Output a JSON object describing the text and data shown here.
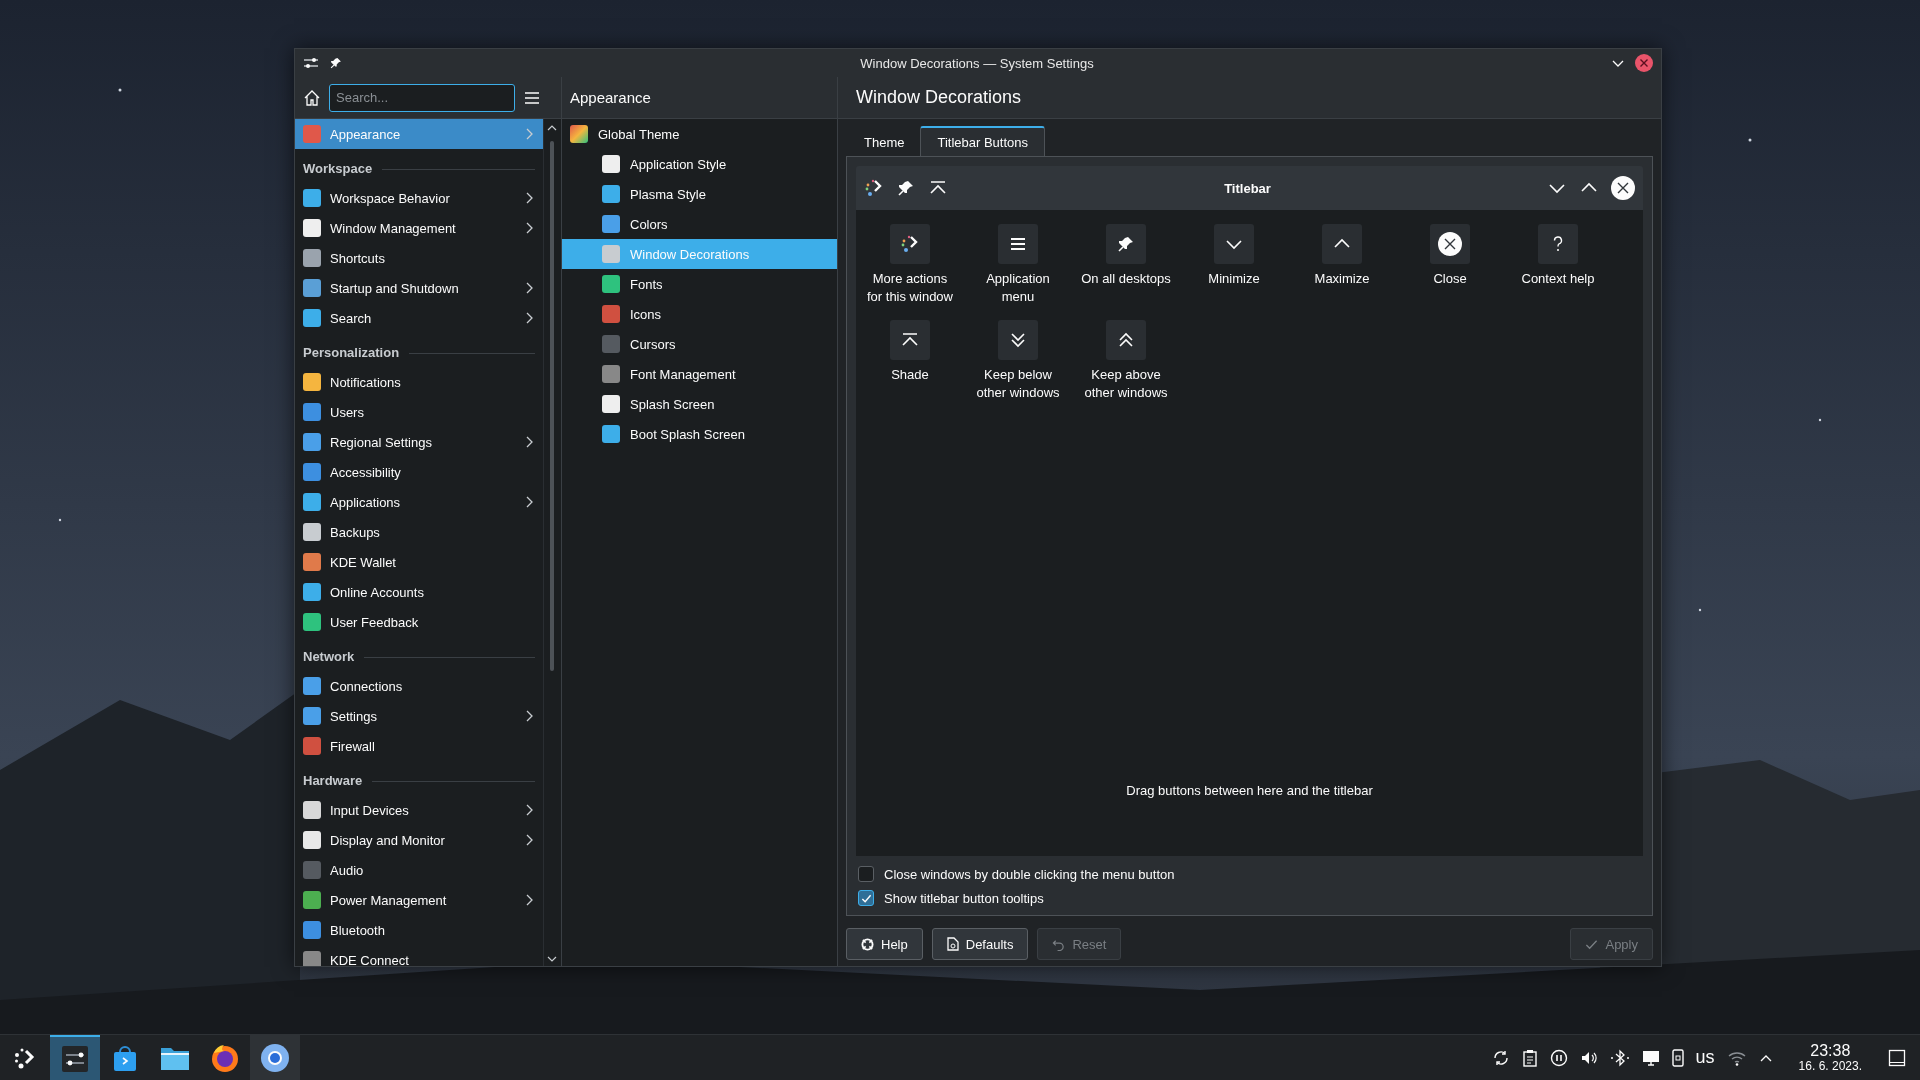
{
  "window": {
    "title": "Window Decorations — System Settings"
  },
  "sidebar": {
    "search": {
      "placeholder": "Search..."
    },
    "items": [
      {
        "kind": "item",
        "label": "Appearance",
        "selected": true,
        "expandable": true
      },
      {
        "kind": "header",
        "label": "Workspace"
      },
      {
        "kind": "item",
        "label": "Workspace Behavior",
        "selected": false,
        "expandable": true
      },
      {
        "kind": "item",
        "label": "Window Management",
        "selected": false,
        "expandable": true
      },
      {
        "kind": "item",
        "label": "Shortcuts",
        "selected": false,
        "expandable": false
      },
      {
        "kind": "item",
        "label": "Startup and Shutdown",
        "selected": false,
        "expandable": true
      },
      {
        "kind": "item",
        "label": "Search",
        "selected": false,
        "expandable": true
      },
      {
        "kind": "header",
        "label": "Personalization"
      },
      {
        "kind": "item",
        "label": "Notifications",
        "selected": false,
        "expandable": false
      },
      {
        "kind": "item",
        "label": "Users",
        "selected": false,
        "expandable": false
      },
      {
        "kind": "item",
        "label": "Regional Settings",
        "selected": false,
        "expandable": true
      },
      {
        "kind": "item",
        "label": "Accessibility",
        "selected": false,
        "expandable": false
      },
      {
        "kind": "item",
        "label": "Applications",
        "selected": false,
        "expandable": true
      },
      {
        "kind": "item",
        "label": "Backups",
        "selected": false,
        "expandable": false
      },
      {
        "kind": "item",
        "label": "KDE Wallet",
        "selected": false,
        "expandable": false
      },
      {
        "kind": "item",
        "label": "Online Accounts",
        "selected": false,
        "expandable": false
      },
      {
        "kind": "item",
        "label": "User Feedback",
        "selected": false,
        "expandable": false
      },
      {
        "kind": "header",
        "label": "Network"
      },
      {
        "kind": "item",
        "label": "Connections",
        "selected": false,
        "expandable": false
      },
      {
        "kind": "item",
        "label": "Settings",
        "selected": false,
        "expandable": true
      },
      {
        "kind": "item",
        "label": "Firewall",
        "selected": false,
        "expandable": false
      },
      {
        "kind": "header",
        "label": "Hardware"
      },
      {
        "kind": "item",
        "label": "Input Devices",
        "selected": false,
        "expandable": true
      },
      {
        "kind": "item",
        "label": "Display and Monitor",
        "selected": false,
        "expandable": true
      },
      {
        "kind": "item",
        "label": "Audio",
        "selected": false,
        "expandable": false
      },
      {
        "kind": "item",
        "label": "Power Management",
        "selected": false,
        "expandable": true
      },
      {
        "kind": "item",
        "label": "Bluetooth",
        "selected": false,
        "expandable": false
      },
      {
        "kind": "item",
        "label": "KDE Connect",
        "selected": false,
        "expandable": false
      }
    ]
  },
  "subpanel": {
    "title": "Appearance",
    "items": [
      {
        "label": "Global Theme",
        "selected": false,
        "children": [
          {
            "label": "Application Style",
            "selected": false
          },
          {
            "label": "Plasma Style",
            "selected": false
          },
          {
            "label": "Colors",
            "selected": false
          },
          {
            "label": "Window Decorations",
            "selected": true
          },
          {
            "label": "Fonts",
            "selected": false
          },
          {
            "label": "Icons",
            "selected": false
          },
          {
            "label": "Cursors",
            "selected": false
          },
          {
            "label": "Font Management",
            "selected": false
          },
          {
            "label": "Splash Screen",
            "selected": false
          },
          {
            "label": "Boot Splash Screen",
            "selected": false
          }
        ]
      }
    ]
  },
  "page": {
    "title": "Window Decorations",
    "tabs": [
      {
        "label": "Theme",
        "selected": false
      },
      {
        "label": "Titlebar Buttons",
        "selected": true
      }
    ],
    "titlebar_preview": {
      "title": "Titlebar",
      "left_buttons": [
        {
          "kind": "more"
        },
        {
          "kind": "pin"
        },
        {
          "kind": "shade"
        }
      ],
      "right_buttons": [
        {
          "kind": "minimize"
        },
        {
          "kind": "maximize"
        },
        {
          "kind": "close"
        }
      ]
    },
    "available_buttons": [
      {
        "kind": "more",
        "label": "More actions for this window"
      },
      {
        "kind": "menu",
        "label": "Application menu"
      },
      {
        "kind": "pin",
        "label": "On all desktops"
      },
      {
        "kind": "minimize",
        "label": "Minimize"
      },
      {
        "kind": "maximize",
        "label": "Maximize"
      },
      {
        "kind": "close",
        "label": "Close"
      },
      {
        "kind": "help",
        "label": "Context help"
      },
      {
        "kind": "shade",
        "label": "Shade"
      },
      {
        "kind": "below",
        "label": "Keep below other windows"
      },
      {
        "kind": "above",
        "label": "Keep above other windows"
      }
    ],
    "hint": "Drag buttons between here and the titlebar",
    "options": [
      {
        "label": "Close windows by double clicking the menu button",
        "checked": false
      },
      {
        "label": "Show titlebar button tooltips",
        "checked": true
      }
    ],
    "buttons": [
      {
        "kind": "help",
        "label": "Help",
        "disabled": false
      },
      {
        "kind": "defaults",
        "label": "Defaults",
        "disabled": false
      },
      {
        "kind": "reset",
        "label": "Reset",
        "disabled": true
      },
      {
        "kind": "apply",
        "label": "Apply",
        "disabled": true
      }
    ]
  },
  "taskbar": {
    "tasks": [
      {
        "kind": "launcher",
        "selected": false
      },
      {
        "kind": "settings",
        "selected": true
      },
      {
        "kind": "store",
        "selected": false
      },
      {
        "kind": "files",
        "selected": false
      },
      {
        "kind": "firefox",
        "selected": false
      },
      {
        "kind": "chromium",
        "selected": false,
        "running": true
      }
    ],
    "tray": {
      "keyboard_layout": "us",
      "time": "23:38",
      "date": "16. 6. 2023."
    }
  }
}
